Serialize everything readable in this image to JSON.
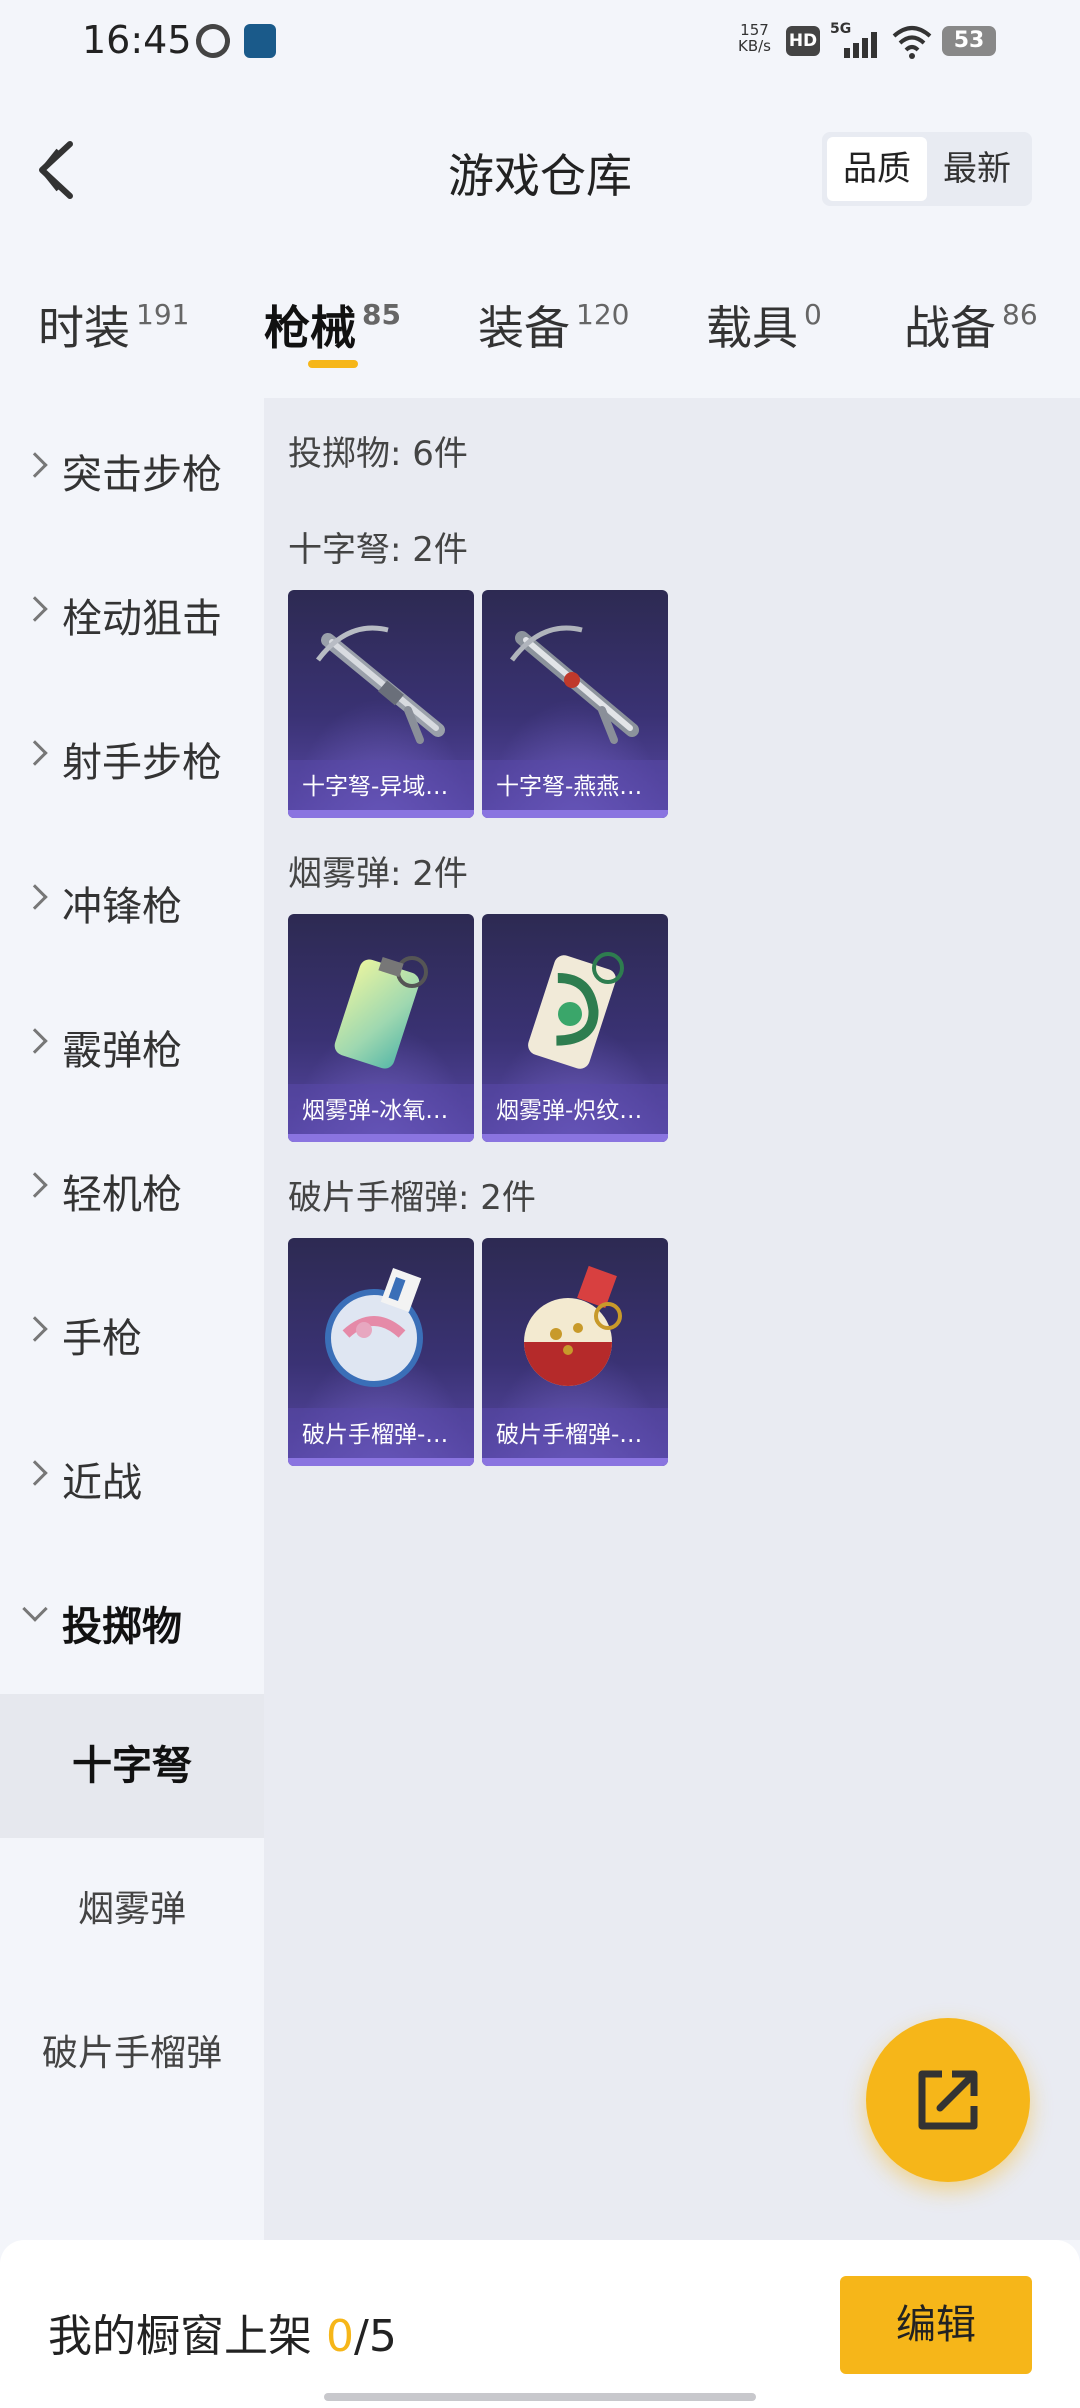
{
  "status_bar": {
    "time": "16:45",
    "net_speed_value": "157",
    "net_speed_unit": "KB/s",
    "hd_label": "HD",
    "network_label": "5G",
    "battery": "53"
  },
  "header": {
    "title": "游戏仓库",
    "sort_options": [
      "品质",
      "最新"
    ],
    "sort_selected": "品质"
  },
  "tabs": [
    {
      "label": "时装",
      "count": "191"
    },
    {
      "label": "枪械",
      "count": "85"
    },
    {
      "label": "装备",
      "count": "120"
    },
    {
      "label": "载具",
      "count": "0"
    },
    {
      "label": "战备",
      "count": "86"
    }
  ],
  "active_tab": "枪械",
  "sidebar": {
    "categories": [
      "突击步枪",
      "栓动狙击",
      "射手步枪",
      "冲锋枪",
      "霰弹枪",
      "轻机枪",
      "手枪",
      "近战",
      "投掷物"
    ],
    "expanded": "投掷物",
    "subcategories": [
      "十字弩",
      "烟雾弹",
      "破片手榴弹"
    ],
    "active_sub": "十字弩"
  },
  "content": {
    "summary": "投掷物: 6件",
    "groups": [
      {
        "label": "十字弩: 2件",
        "items": [
          "十字弩-异域…",
          "十字弩-燕燕…"
        ]
      },
      {
        "label": "烟雾弹: 2件",
        "items": [
          "烟雾弹-冰氧…",
          "烟雾弹-炽纹…"
        ]
      },
      {
        "label": "破片手榴弹: 2件",
        "items": [
          "破片手榴弹-…",
          "破片手榴弹-…"
        ]
      }
    ]
  },
  "bottom_bar": {
    "showcase_prefix": "我的橱窗上架 ",
    "showcase_current": "0",
    "showcase_total": "/5",
    "edit_label": "编辑"
  },
  "colors": {
    "accent": "#f6b619",
    "card_bg": "#3a3274",
    "page_bg": "#f3f5fa"
  }
}
